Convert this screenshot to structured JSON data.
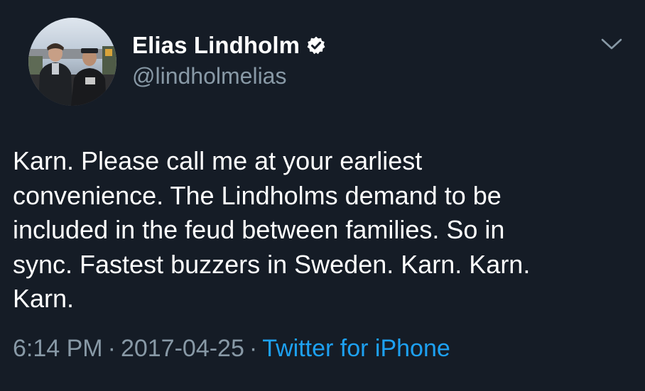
{
  "tweet": {
    "author": {
      "display_name": "Elias Lindholm",
      "handle": "@lindholmelias",
      "verified": true,
      "avatar_icon": "profile-photo"
    },
    "text": "Karn. Please call me at your earliest\nconvenience. The Lindholms demand to be\nincluded in the feud between families. So in\nsync. Fastest buzzers in Sweden. Karn. Karn.\nKarn.",
    "time": "6:14 PM",
    "date": "2017-04-25",
    "separator": "·",
    "source": "Twitter for iPhone",
    "menu_icon": "chevron-down-icon"
  },
  "colors": {
    "background": "#151c26",
    "text": "#ffffff",
    "secondary": "#8899a6",
    "link": "#1da1f2"
  }
}
